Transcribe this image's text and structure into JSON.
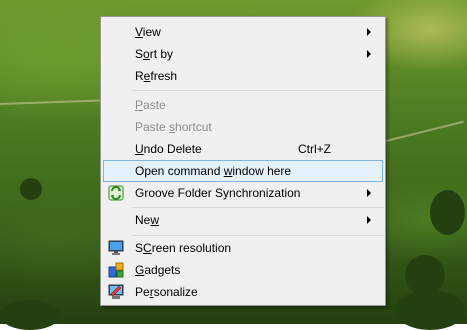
{
  "menu": {
    "items": [
      {
        "label": "View",
        "accel": "V",
        "submenu": true
      },
      {
        "label": "Sort by",
        "accel": "o",
        "submenu": true
      },
      {
        "label": "Refresh",
        "accel": "e"
      },
      {
        "label": "Paste",
        "accel": "P",
        "disabled": true
      },
      {
        "label": "Paste shortcut",
        "accel": "s",
        "disabled": true
      },
      {
        "label": "Undo Delete",
        "accel": "U",
        "shortcut": "Ctrl+Z"
      },
      {
        "label": "Open command window here",
        "accel": "w",
        "highlighted": true
      },
      {
        "label": "Groove Folder Synchronization",
        "icon": "groove-sync-icon",
        "submenu": true
      },
      {
        "label": "New",
        "accel": "w",
        "submenu": true
      },
      {
        "label": "Screen resolution",
        "accel": "C",
        "icon": "monitor-icon"
      },
      {
        "label": "Gadgets",
        "accel": "G",
        "icon": "gadgets-icon"
      },
      {
        "label": "Personalize",
        "accel": "r",
        "icon": "personalize-icon"
      }
    ]
  }
}
